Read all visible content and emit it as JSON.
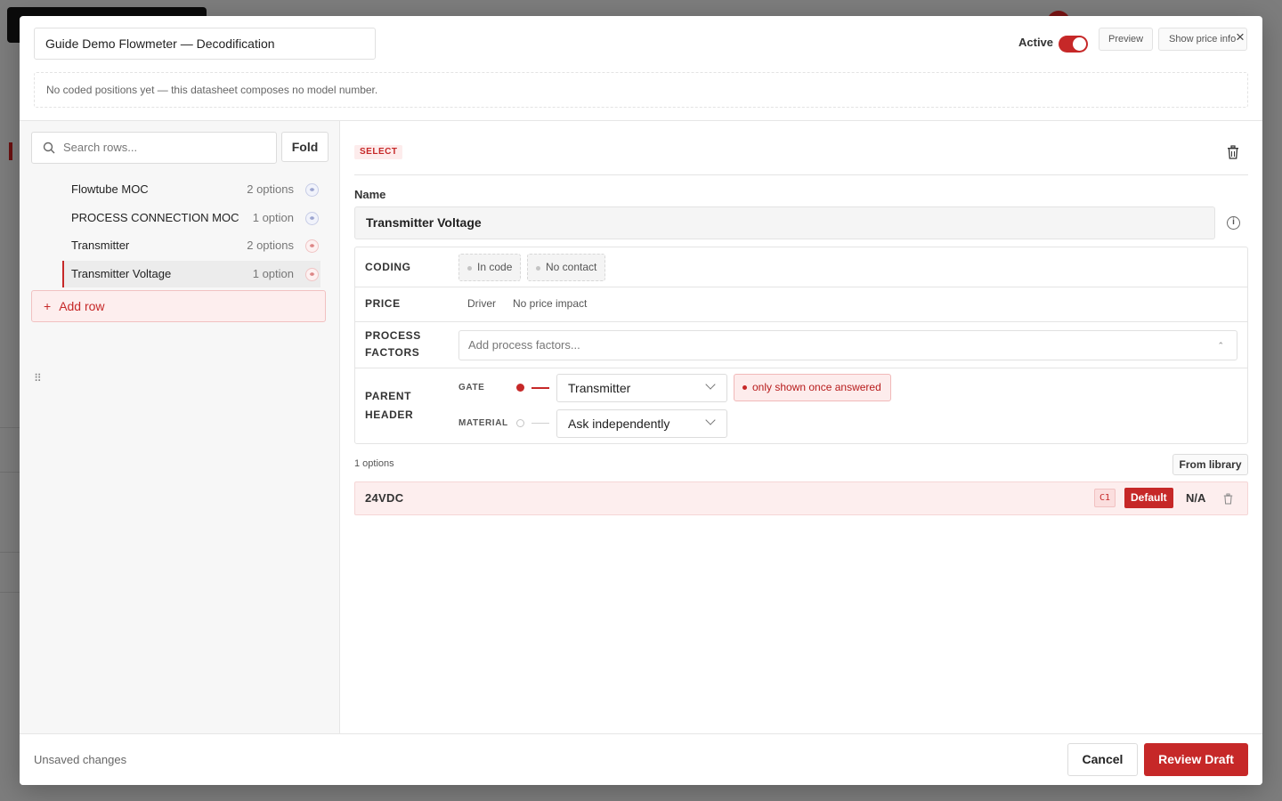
{
  "header": {
    "title_value": "Guide Demo Flowmeter — Decodification",
    "active_label": "Active",
    "active_on": true,
    "preview_label": "Preview",
    "show_price_label": "Show price info",
    "close_glyph": "×",
    "notice": "No coded positions yet — this datasheet composes no model number."
  },
  "sidebar": {
    "search_placeholder": "Search rows...",
    "fold_label": "Fold",
    "drag_glyph": "⠿",
    "rows": [
      {
        "name": "Flowtube MOC",
        "count": "2 options",
        "link_icon": "link-icon",
        "link_color": "blue"
      },
      {
        "name": "PROCESS CONNECTION MOC",
        "count": "1 option",
        "link_icon": "link-icon",
        "link_color": "blue"
      },
      {
        "name": "Transmitter",
        "count": "2 options",
        "link_icon": "link-icon",
        "link_color": "red"
      },
      {
        "name": "Transmitter Voltage",
        "count": "1 option",
        "link_icon": "link-icon",
        "link_color": "red",
        "selected": true
      }
    ],
    "add_row_label": "Add row",
    "add_row_glyph": "+"
  },
  "editor": {
    "type_tag": "SELECT",
    "name_label": "Name",
    "name_value": "Transmitter Voltage",
    "properties": {
      "coding_label": "CODING",
      "coding_chips": [
        "In code",
        "No contact"
      ],
      "price_label": "PRICE",
      "price_driver": "Driver",
      "price_impact": "No price impact",
      "process_factors_label_1": "PROCESS",
      "process_factors_label_2": "FACTORS",
      "process_factors_placeholder": "Add process factors...",
      "parent_header_label_1": "PARENT",
      "parent_header_label_2": "HEADER",
      "gate_label": "GATE",
      "gate_value": "Transmitter",
      "gate_note": "only shown once answered",
      "material_label": "MATERIAL",
      "material_value": "Ask independently"
    },
    "options_count": "1 options",
    "from_library_label": "From library",
    "options": [
      {
        "name": "24VDC",
        "code": "C1",
        "default_label": "Default",
        "price": "N/A"
      }
    ]
  },
  "footer": {
    "status": "Unsaved changes",
    "cancel_label": "Cancel",
    "review_label": "Review Draft"
  },
  "colors": {
    "accent": "#c62828",
    "accent_soft": "#fdeeee"
  }
}
